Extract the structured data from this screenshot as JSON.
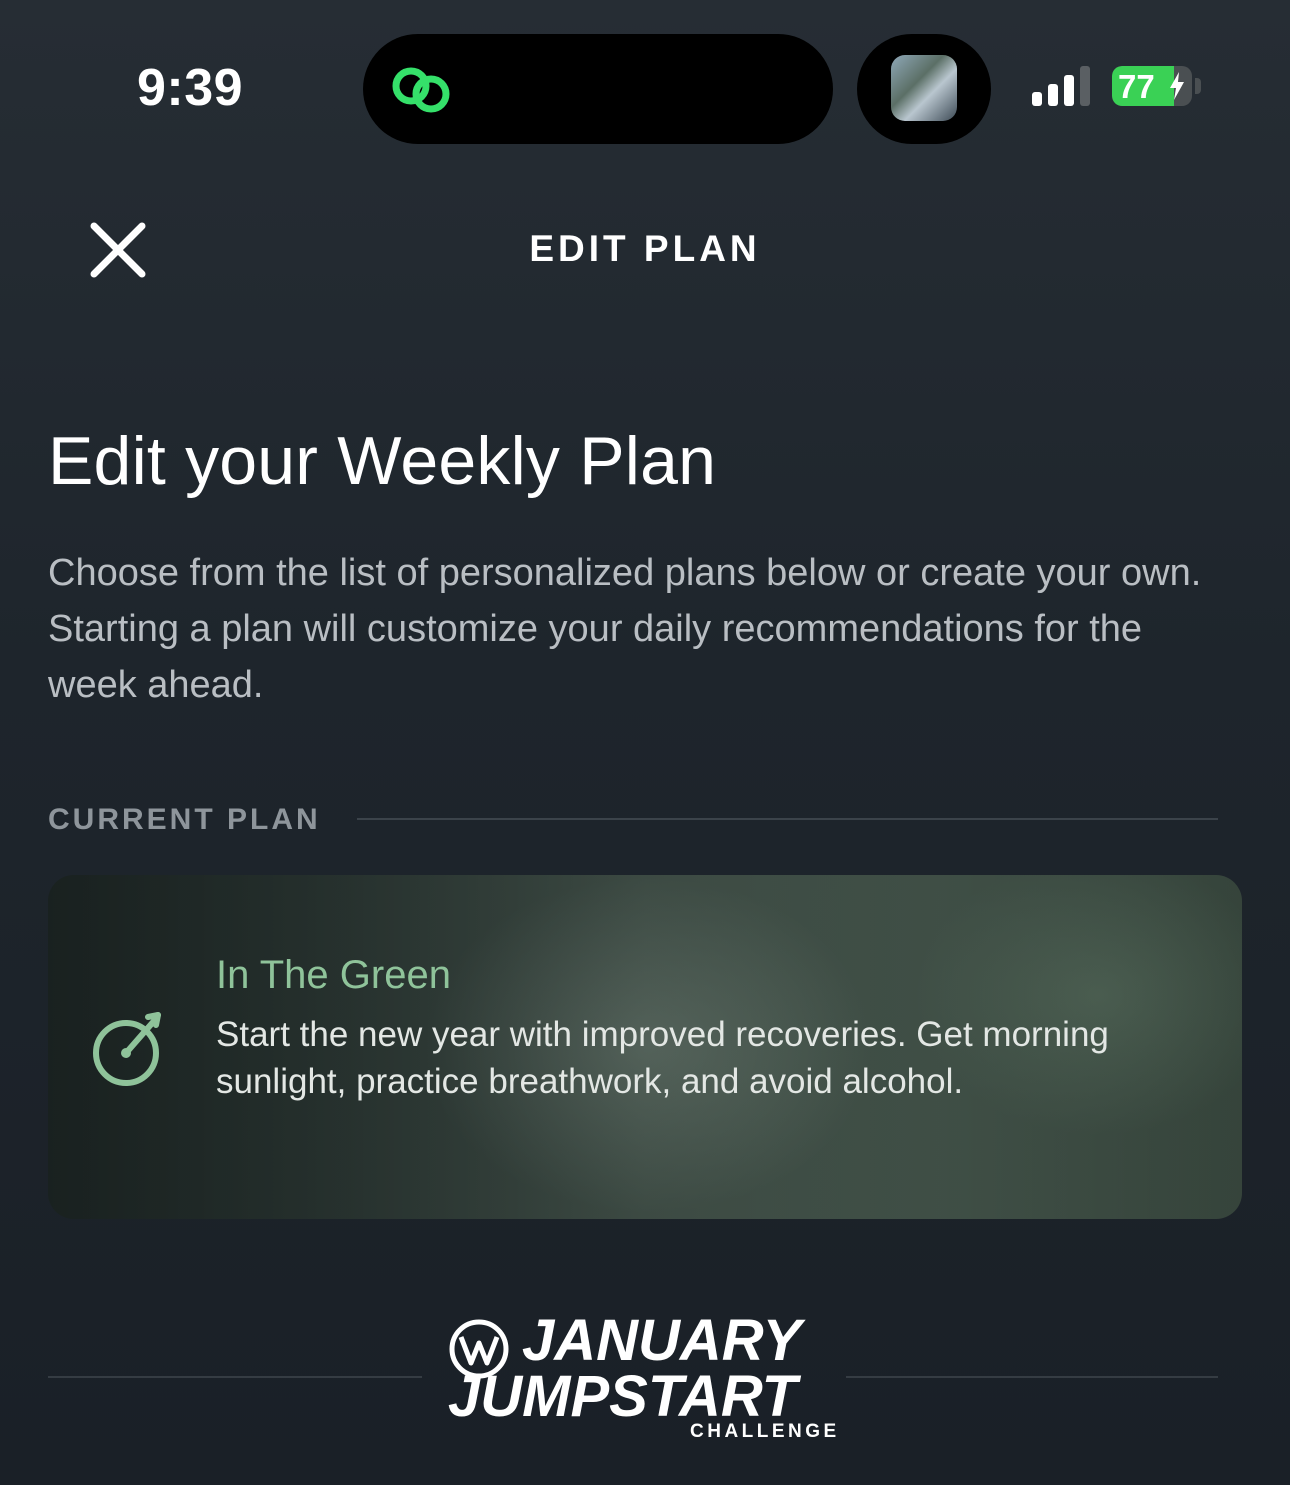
{
  "status_bar": {
    "time": "9:39",
    "battery_level": "77",
    "battery_percent": 77,
    "icons": [
      "link-icon",
      "signal-icon",
      "battery-icon",
      "charging-bolt-icon"
    ]
  },
  "header": {
    "title": "EDIT PLAN",
    "close_icon": "close-icon"
  },
  "main": {
    "title": "Edit your Weekly Plan",
    "intro": "Choose from the list of personalized plans below or create your own. Starting a plan will customize your daily recommendations for the week ahead.",
    "section_label": "CURRENT PLAN"
  },
  "current_plan": {
    "name": "In The Green",
    "description": "Start the new year with improved recoveries. Get morning sunlight, practice breathwork, and avoid alcohol.",
    "icon": "target-icon"
  },
  "challenge_logo": {
    "line1": "JANUARY",
    "line2": "JUMPSTART",
    "line3": "CHALLENGE"
  },
  "colors": {
    "background": "#1e252c",
    "accent_green": "#8fc39a",
    "battery_green": "#3ad155",
    "island_link_green": "#35e06a",
    "muted_text": "#b9bec3"
  }
}
